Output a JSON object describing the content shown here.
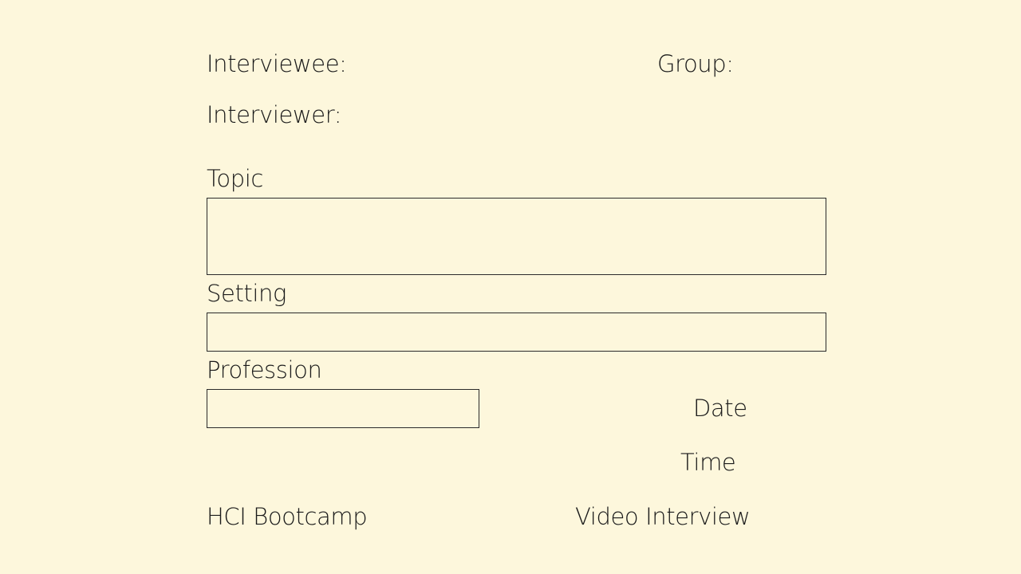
{
  "form": {
    "interviewee_label": "Interviewee:",
    "group_label": "Group:",
    "interviewer_label": "Interviewer:",
    "topic_label": "Topic",
    "setting_label": "Setting",
    "profession_label": "Profession",
    "date_label": "Date",
    "time_label": "Time"
  },
  "footer": {
    "left_text": "HCI Bootcamp",
    "right_text": "Video Interview"
  },
  "colors": {
    "background": "#fdf7dc",
    "text": "#1a1a1a",
    "border": "#2a2a2a"
  }
}
